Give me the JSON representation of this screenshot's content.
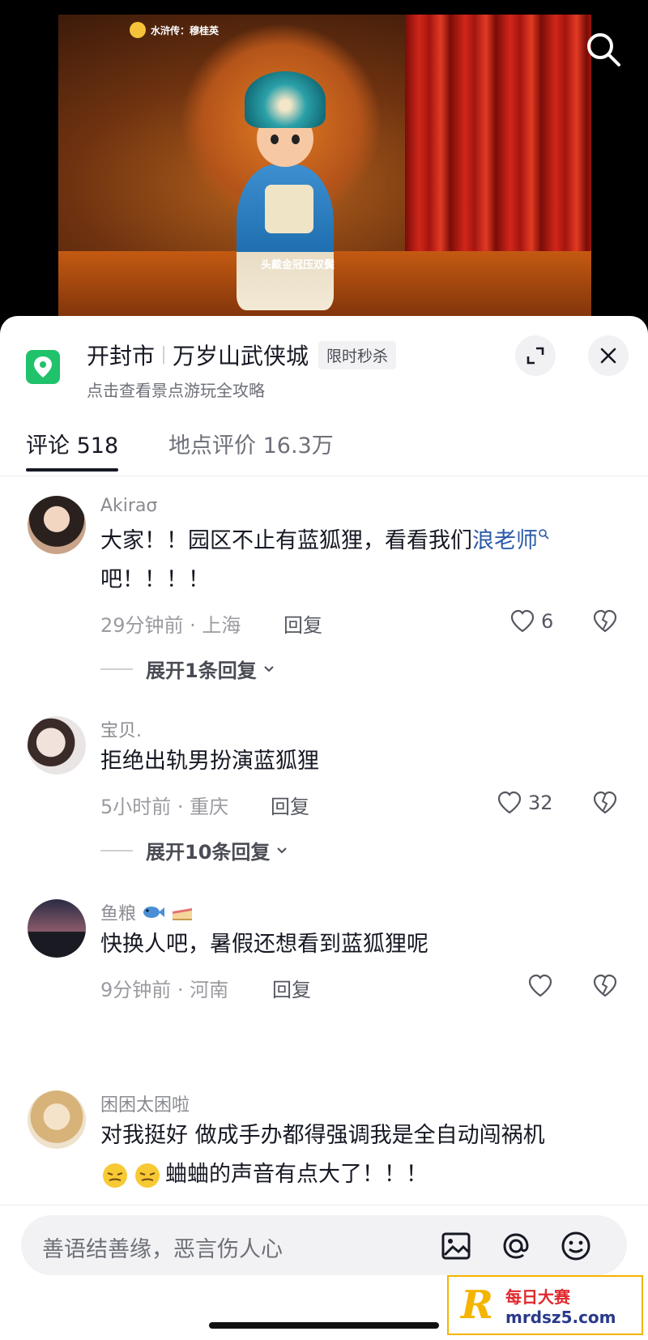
{
  "video": {
    "chip_text": "水浒传：穆桂英",
    "caption": "头戴金冠压双鬓"
  },
  "location": {
    "city": "开封市",
    "place": "万岁山武侠城",
    "badge": "限时秒杀",
    "subtitle": "点击查看景点游玩全攻略"
  },
  "tabs": [
    {
      "label": "评论 518",
      "active": true
    },
    {
      "label": "地点评价 16.3万",
      "active": false
    }
  ],
  "comments": [
    {
      "user": "Akiraσ",
      "text_main": "大家！！园区不止有蓝狐狸，看看我们",
      "text_link": "浪老师",
      "text_tail": "吧！！！！",
      "meta": "29分钟前 · 上海",
      "reply_label": "回复",
      "likes": "6",
      "expand_label": "展开1条回复"
    },
    {
      "user": "宝贝.",
      "text": "拒绝出轨男扮演蓝狐狸",
      "meta": "5小时前 · 重庆",
      "reply_label": "回复",
      "likes": "32",
      "expand_label": "展开10条回复"
    },
    {
      "user": "鱼粮",
      "user_emojis": [
        "fish-emoji",
        "cake-emoji"
      ],
      "text": "快换人吧，暑假还想看到蓝狐狸呢",
      "meta": "9分钟前 · 河南",
      "reply_label": "回复",
      "likes": ""
    },
    {
      "user": "困困太困啦",
      "text_line1": "对我挺好 做成手办都得强调我是全自动闯祸机",
      "text_line2": "蛐蛐的声音有点大了！！！",
      "emojis": [
        "squint-emoji",
        "squint-emoji"
      ]
    }
  ],
  "input": {
    "placeholder": "善语结善缘，恶言伤人心"
  },
  "watermark": {
    "logo": "R",
    "title": "每日大赛",
    "url": "mrdsz5.com"
  },
  "colors": {
    "accent_green": "#20c26b",
    "link_blue": "#2b5aa8",
    "text_primary": "#161823",
    "text_secondary": "#8a8b91"
  }
}
